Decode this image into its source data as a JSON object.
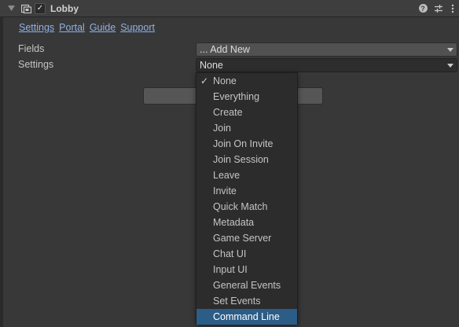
{
  "header": {
    "title": "Lobby",
    "icons": [
      "foldout-arrow-icon",
      "script-icon",
      "enabled-checkbox",
      "help-icon",
      "preset-icon",
      "more-options-icon"
    ]
  },
  "links": [
    "Settings",
    "Portal",
    "Guide",
    "Support"
  ],
  "fields": {
    "label": "Fields",
    "value": "... Add New"
  },
  "settings": {
    "label": "Settings",
    "value": "None"
  },
  "menu": {
    "checked": "None",
    "highlighted": "Command Line",
    "items": [
      "None",
      "Everything",
      "Create",
      "Join",
      "Join On Invite",
      "Join Session",
      "Leave",
      "Invite",
      "Quick Match",
      "Metadata",
      "Game Server",
      "Chat UI",
      "Input UI",
      "General Events",
      "Set Events",
      "Command Line"
    ]
  },
  "colors": {
    "background": "#383838",
    "link": "#8eb1e6",
    "highlight": "#2c5d87",
    "popup": "#2c2c2c"
  }
}
